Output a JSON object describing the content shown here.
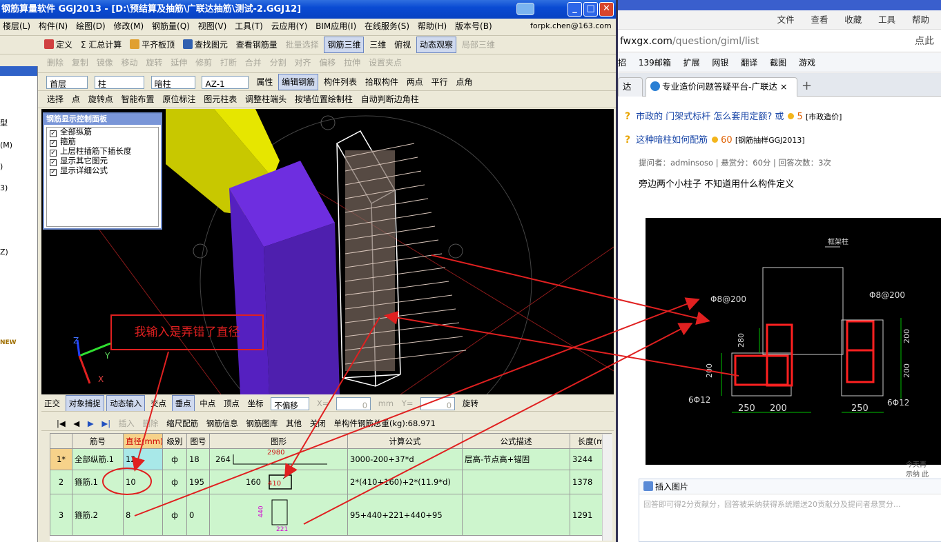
{
  "app": {
    "title": "钢筋算量软件 GGJ2013 - [D:\\预结算及抽筋\\广联达抽筋\\测试-2.GGJ12]"
  },
  "menu": [
    "楼层(L)",
    "构件(N)",
    "绘图(D)",
    "修改(M)",
    "钢筋量(Q)",
    "视图(V)",
    "工具(T)",
    "云应用(Y)",
    "BIM应用(I)",
    "在线服务(S)",
    "帮助(H)",
    "版本号(B)"
  ],
  "user_email": "forpk.chen@163.com",
  "toolbar1": [
    "定义",
    "Σ 汇总计算",
    "平齐板顶",
    "查找图元",
    "查看钢筋量",
    "批量选择",
    "钢筋三维",
    "三维",
    "俯视",
    "动态观察",
    "局部三维"
  ],
  "toolbar2": [
    "删除",
    "复制",
    "镜像",
    "移动",
    "旋转",
    "延伸",
    "修剪",
    "打断",
    "合并",
    "分割",
    "对齐",
    "偏移",
    "拉伸",
    "设置夹点"
  ],
  "toolbar3": {
    "floor": "首层",
    "type": "柱",
    "subtype": "暗柱",
    "name": "AZ-1",
    "buttons": [
      "属性",
      "编辑钢筋",
      "构件列表",
      "拾取构件",
      "两点",
      "平行",
      "点角"
    ]
  },
  "toolbar4": [
    "选择",
    "点",
    "旋转点",
    "智能布置",
    "原位标注",
    "图元柱表",
    "调整柱端头",
    "按墙位置绘制柱",
    "自动判断边角柱"
  ],
  "left_panel": [
    "型",
    "(M)",
    ")",
    "3)",
    "Z)",
    "NEW"
  ],
  "control_panel": {
    "title": "钢筋显示控制面板",
    "items": [
      "全部纵筋",
      "箍筋",
      "上层柱插筋下插长度",
      "显示其它图元",
      "显示详细公式"
    ]
  },
  "annotation": {
    "text": "我输入是弄错了直径",
    "color": "#e02020"
  },
  "axes": {
    "x": "X",
    "y": "Y",
    "z": "Z"
  },
  "snapbar": {
    "items": [
      "正交",
      "对象捕捉",
      "动态输入",
      "交点",
      "垂点",
      "中点",
      "顶点",
      "坐标"
    ],
    "offset_mode": "不偏移",
    "x_label": "X=",
    "x_value": "0",
    "unit": "mm",
    "y_label": "Y=",
    "y_value": "0",
    "rotate": "旋转"
  },
  "gridbar": {
    "buttons": [
      "插入",
      "删除",
      "缩尺配筋",
      "钢筋信息",
      "钢筋图库",
      "其他",
      "关闭"
    ],
    "total": "单构件钢筋总重(kg):68.971"
  },
  "table": {
    "headers": [
      "筋号",
      "直径(mm)",
      "级别",
      "图号",
      "图形",
      "计算公式",
      "公式描述",
      "长度(m"
    ],
    "rows": [
      {
        "num": "1*",
        "name": "全部纵筋.1",
        "dia": "12",
        "grade": "ф",
        "fig": "18",
        "shape_a": "264",
        "shape_b": "2980",
        "formula": "3000-200+37*d",
        "desc": "层高-节点高+锚固",
        "len": "3244"
      },
      {
        "num": "2",
        "name": "箍筋.1",
        "dia": "10",
        "grade": "ф",
        "fig": "195",
        "shape_a": "160",
        "shape_b": "410",
        "formula": "2*(410+160)+2*(11.9*d)",
        "desc": "",
        "len": "1378"
      },
      {
        "num": "3",
        "name": "箍筋.2",
        "dia": "8",
        "grade": "ф",
        "fig": "0",
        "shape_a": "440",
        "shape_b": "221",
        "formula": "95+440+221+440+95",
        "desc": "",
        "len": "1291"
      }
    ]
  },
  "browser": {
    "menu": [
      "文件",
      "查看",
      "收藏",
      "工具",
      "帮助"
    ],
    "url": "fwxgx.com/question/giml/list",
    "url_host": "fwxgx.com",
    "url_path": "/question/giml/list",
    "search_hint": "点此",
    "fav": [
      "139邮箱",
      "扩展",
      "网银",
      "翻译",
      "截图",
      "游戏"
    ],
    "fav_partial": "招",
    "tab_label": "专业造价问题答疑平台-广联达",
    "tab_partial": "达"
  },
  "questions": [
    {
      "title": "市政的 门架式标杆 怎么套用定额? 或",
      "coins": "5",
      "tag": "[市政造价]"
    },
    {
      "title": "这种暗柱如何配筋",
      "coins": "60",
      "tag": "[钢筋抽样GGJ2013]"
    }
  ],
  "question_meta": "提问者：adminsoso | 悬赏分：60分 | 回答次数：3次",
  "question_text": "旁边两个小柱子 不知道用什么构件定义",
  "cad": {
    "title": "框架柱",
    "labels": [
      "Φ8@200",
      "Φ8@200",
      "280",
      "200",
      "200",
      "200",
      "6Φ12",
      "6Φ12",
      "250",
      "200",
      "250"
    ]
  },
  "answer": {
    "insert_image": "插入图片",
    "placeholder": "回答即可得2分贡献分，回答被采纳获得系统赠送20贡献分及提问者悬赏分..."
  },
  "side_snippet": [
    "今天再",
    "示纳 此"
  ]
}
